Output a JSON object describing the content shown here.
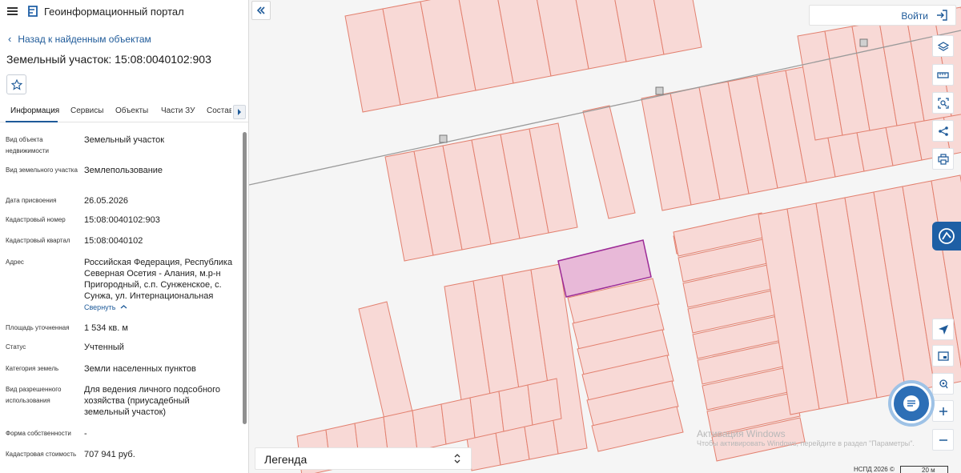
{
  "header": {
    "app_title": "Геоинформационный портал"
  },
  "nav": {
    "back_label": "Назад к найденным объектам"
  },
  "page": {
    "title": "Земельный участок: 15:08:0040102:903"
  },
  "tabs": [
    {
      "label": "Информация",
      "active": true
    },
    {
      "label": "Сервисы",
      "active": false
    },
    {
      "label": "Объекты",
      "active": false
    },
    {
      "label": "Части ЗУ",
      "active": false
    },
    {
      "label": "Состав",
      "active": false
    }
  ],
  "properties": [
    {
      "label": "Вид объекта недвижимости",
      "value": "Земельный участок"
    },
    {
      "label": "Вид земельного участка",
      "value": "Землепользование"
    },
    {
      "label": "Дата присвоения",
      "value": "26.05.2026"
    },
    {
      "label": "Кадастровый номер",
      "value": "15:08:0040102:903"
    },
    {
      "label": "Кадастровый квартал",
      "value": "15:08:0040102"
    },
    {
      "label": "Адрес",
      "value": "Российская Федерация, Республика Северная Осетия - Алания, м.р-н Пригородный, с.п. Сунженское, с. Сунжа, ул. Интернациональная",
      "action": "Свернуть"
    },
    {
      "label": "Площадь уточненная",
      "value": "1 534 кв. м"
    },
    {
      "label": "Статус",
      "value": "Учтенный"
    },
    {
      "label": "Категория земель",
      "value": "Земли населенных пунктов"
    },
    {
      "label": "Вид разрешенного использования",
      "value": "Для ведения личного подсобного хозяйства (приусадебный земельный участок)"
    },
    {
      "label": "Форма собственности",
      "value": "-"
    },
    {
      "label": "Кадастровая стоимость",
      "value": "707 941 руб."
    }
  ],
  "map": {
    "login_label": "Войти",
    "legend_label": "Легенда",
    "watermark_title": "Активация Windows",
    "watermark_text": "Чтобы активировать Windows, перейдите в раздел \"Параметры\".",
    "attribution": "НСПД 2026 ©",
    "scale_label": "20 м",
    "colors": {
      "parcel_fill": "#f8d9d6",
      "parcel_stroke": "#e2806f",
      "selected_fill": "#e8b9d8",
      "selected_stroke": "#9c2a96",
      "accent": "#1e5fa5"
    }
  }
}
